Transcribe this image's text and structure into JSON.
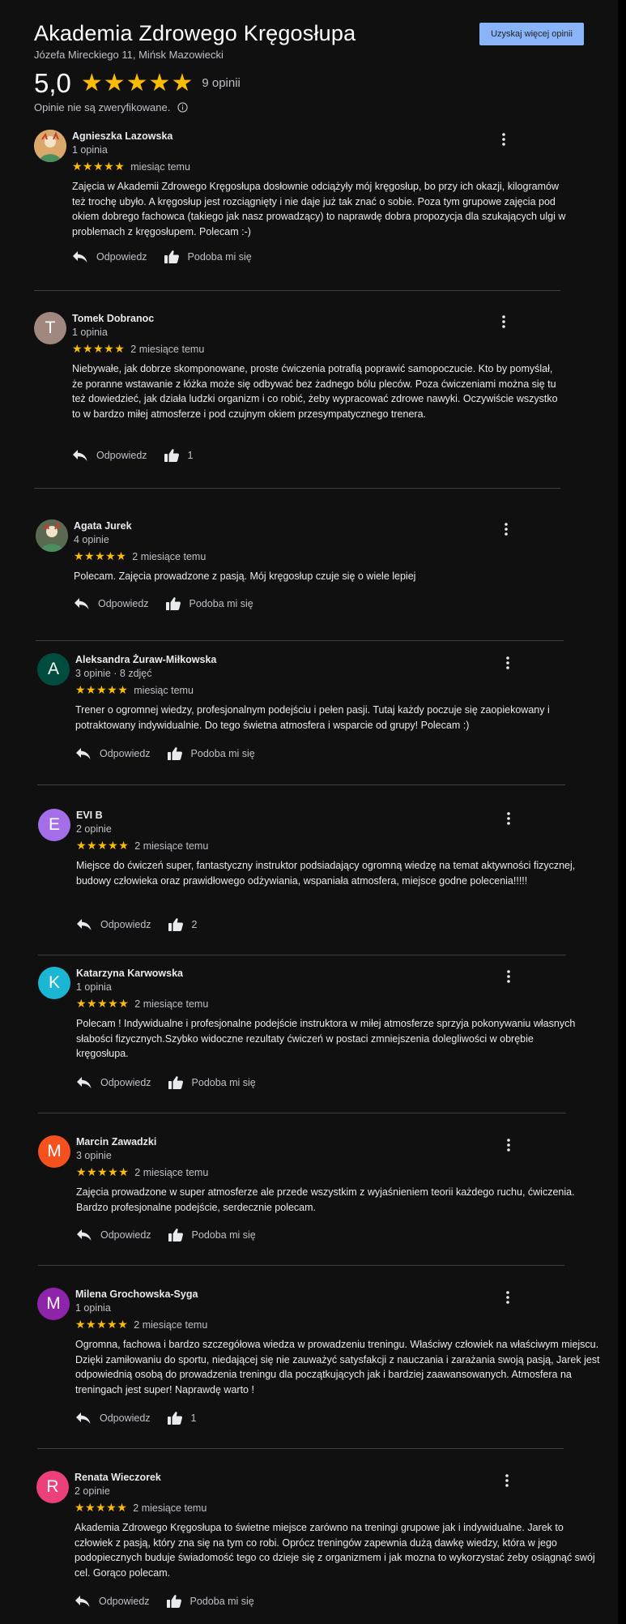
{
  "header": {
    "title": "Akademia Zdrowego Kręgosłupa",
    "address": "Józefa Mireckiego 11, Mińsk Mazowiecki",
    "cta_label": "Uzyskaj więcej opinii"
  },
  "summary": {
    "rating": "5,0",
    "stars": "★★★★★",
    "count_label": "9 opinii",
    "verification_note": "Opinie nie są zweryfikowane."
  },
  "actions": {
    "reply_label": "Odpowiedz",
    "like_label": "Podoba mi się"
  },
  "colors": {
    "background": "#101011",
    "accent": "#8ab4f8",
    "star": "#fbbc04"
  },
  "reviews": [
    {
      "name": "Agnieszka Lazowska",
      "meta": "1 opinia",
      "stars": "★★★★★",
      "date": "miesiąc temu",
      "text": "Zajęcia w Akademii Zdrowego Kręgosłupa dosłownie odciążyły mój kręgosłup, bo przy ich okazji, kilogramów też trochę ubyło. A kręgosłup jest rozciągnięty i nie daje już tak znać o sobie. Poza tym grupowe zajęcia pod okiem dobrego fachowca (takiego jak nasz prowadzący) to naprawdę dobra propozycja dla szukających ulgi w problemach z kręgosłupem. Polecam :-)",
      "likes": "Podoba mi się",
      "avatar": "photo",
      "avatar_color": "#d9a86a",
      "initial": ""
    },
    {
      "name": "Tomek Dobranoc",
      "meta": "1 opinia",
      "stars": "★★★★★",
      "date": "2 miesiące temu",
      "text": "Niebywałe, jak dobrze skomponowane, proste ćwiczenia potrafią poprawić samopoczucie. Kto by pomyślał, że poranne wstawanie z łóżka może się odbywać bez żadnego bólu pleców. Poza ćwiczeniami można się tu też dowiedzieć, jak działa ludzki organizm i co robić, żeby wypracować zdrowe nawyki. Oczywiście wszystko to w bardzo miłej atmosferze i pod czujnym okiem przesympatycznego trenera.",
      "likes": "1",
      "avatar": "initial",
      "avatar_color": "#a1887f",
      "initial": "T"
    },
    {
      "name": "Agata Jurek",
      "meta": "4 opinie",
      "stars": "★★★★★",
      "date": "2 miesiące temu",
      "text": "Polecam. Zajęcia prowadzone z pasją. Mój kręgosłup czuje się o wiele lepiej",
      "likes": "Podoba mi się",
      "avatar": "photo",
      "avatar_color": "#5a6a52",
      "initial": ""
    },
    {
      "name": "Aleksandra Żuraw-Miłkowska",
      "meta": "3 opinie · 8 zdjęć",
      "stars": "★★★★★",
      "date": "miesiąc temu",
      "text": "Trener o ogromnej wiedzy, profesjonalnym podejściu i pełen pasji. Tutaj każdy poczuje się zaopiekowany i potraktowany indywidualnie. Do tego świetna atmosfera i wsparcie od grupy! Polecam :)",
      "likes": "Podoba mi się",
      "avatar": "initial",
      "avatar_color": "#004d40",
      "initial": "A"
    },
    {
      "name": "EVI B",
      "meta": "2 opinie",
      "stars": "★★★★★",
      "date": "2 miesiące temu",
      "text": "Miejsce do ćwiczeń super, fantastyczny instruktor podsiadający ogromną wiedzę na temat aktywności fizycznej, budowy człowieka oraz prawidłowego odżywiania, wspaniała atmosfera, miejsce godne polecenia!!!!!",
      "likes": "2",
      "avatar": "initial",
      "avatar_color": "#a56ee9",
      "initial": "E"
    },
    {
      "name": "Katarzyna Karwowska",
      "meta": "1 opinia",
      "stars": "★★★★★",
      "date": "2 miesiące temu",
      "text": "Polecam ! Indywidualne  i profesjonalne podejście instruktora w miłej atmosferze sprzyja pokonywaniu własnych słabości fizycznych.Szybko widoczne rezultaty ćwiczeń w postaci zmniejszenia dolegliwości w obrębie kręgosłupa.",
      "likes": "Podoba mi się",
      "avatar": "initial",
      "avatar_color": "#1bb6d3",
      "initial": "K"
    },
    {
      "name": "Marcin Zawadzki",
      "meta": "3 opinie",
      "stars": "★★★★★",
      "date": "2 miesiące temu",
      "text": "Zajęcia prowadzone w super atmosferze ale przede wszystkim z wyjaśnieniem teorii każdego ruchu, ćwiczenia. Bardzo profesjonalne podejście, serdecznie polecam.",
      "likes": "Podoba mi się",
      "avatar": "initial",
      "avatar_color": "#f4511e",
      "initial": "M"
    },
    {
      "name": "Milena Grochowska-Syga",
      "meta": "1 opinia",
      "stars": "★★★★★",
      "date": "2 miesiące temu",
      "text": "Ogromna, fachowa i bardzo szczegółowa wiedza w prowadzeniu treningu. Właściwy człowiek na właściwym miejscu.  Dzięki zamiłowaniu do sportu, niedającej się nie zauważyć satysfakcji z nauczania i zarażania swoją pasją, Jarek  jest odpowiednią osobą do prowadzenia treningu dla początkujących jak i bardziej zaawansowanych.  Atmosfera na treningach  jest super! Naprawdę warto !",
      "likes": "1",
      "avatar": "initial",
      "avatar_color": "#8e24aa",
      "initial": "M"
    },
    {
      "name": "Renata Wieczorek",
      "meta": "2 opinie",
      "stars": "★★★★★",
      "date": "2 miesiące temu",
      "text": "Akademia Zdrowego Kręgosłupa to świetne miejsce zarówno na treningi grupowe jak i indywidualne. Jarek to człowiek z pasją, który zna się na tym co robi. Oprócz treningów zapewnia dużą dawkę wiedzy, która w jego podopiecznych buduje świadomość tego co dzieje się z organizmem i jak mozna to wykorzystać żeby osiągnąć swój cel. Gorąco polecam.",
      "likes": "Podoba mi się",
      "avatar": "initial",
      "avatar_color": "#ec407a",
      "initial": "R"
    }
  ]
}
